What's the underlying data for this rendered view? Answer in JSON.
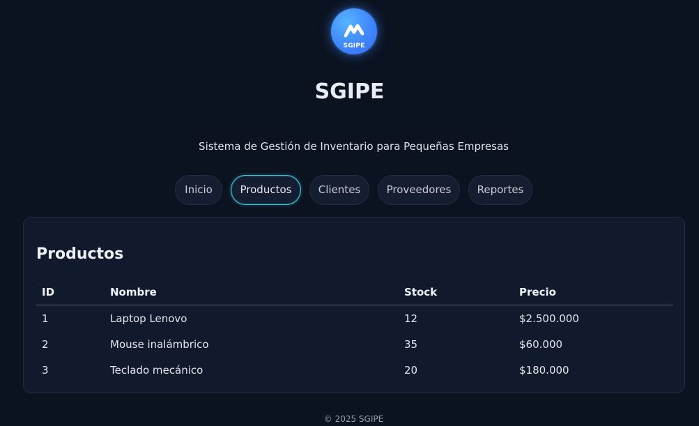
{
  "header": {
    "logo_text": "SGIPE",
    "title": "SGIPE",
    "subtitle": "Sistema de Gestión de Inventario para Pequeñas Empresas"
  },
  "nav": {
    "items": [
      {
        "label": "Inicio",
        "active": false
      },
      {
        "label": "Productos",
        "active": true
      },
      {
        "label": "Clientes",
        "active": false
      },
      {
        "label": "Proveedores",
        "active": false
      },
      {
        "label": "Reportes",
        "active": false
      }
    ]
  },
  "products": {
    "title": "Productos",
    "columns": [
      "ID",
      "Nombre",
      "Stock",
      "Precio"
    ],
    "rows": [
      [
        "1",
        "Laptop Lenovo",
        "12",
        "$2.500.000"
      ],
      [
        "2",
        "Mouse inalámbrico",
        "35",
        "$60.000"
      ],
      [
        "3",
        "Teclado mecánico",
        "20",
        "$180.000"
      ]
    ]
  },
  "footer": {
    "text": "© 2025 SGIPE"
  },
  "colors": {
    "background": "#0b1220",
    "card": "#111a2d",
    "accent": "#3ec4d8",
    "logo": "#3f86ff"
  }
}
